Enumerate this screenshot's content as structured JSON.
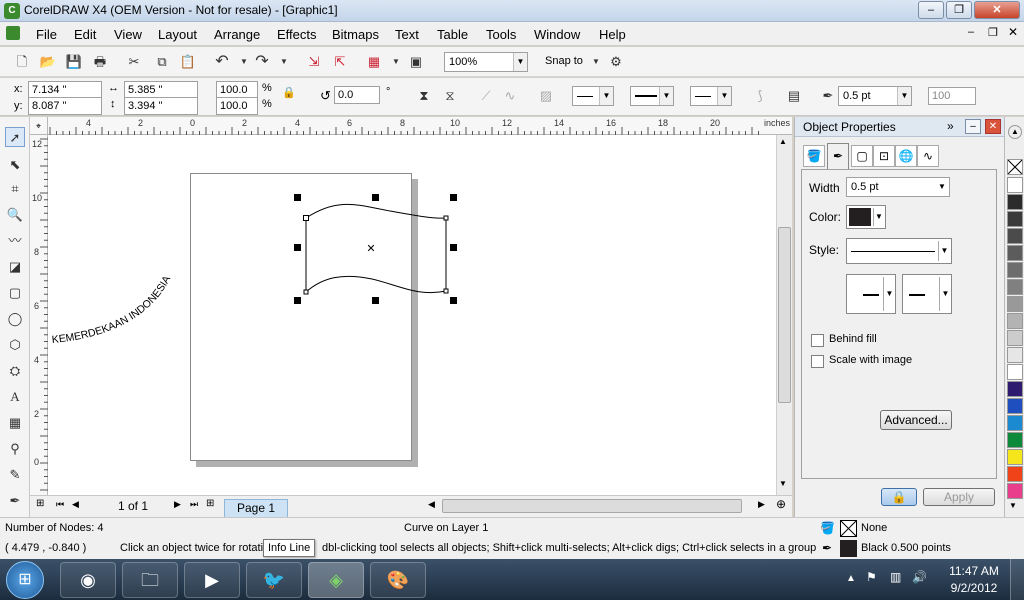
{
  "window": {
    "title": "CorelDRAW X4 (OEM Version - Not for resale) - [Graphic1]"
  },
  "menu": [
    "File",
    "Edit",
    "View",
    "Layout",
    "Arrange",
    "Effects",
    "Bitmaps",
    "Text",
    "Table",
    "Tools",
    "Window",
    "Help"
  ],
  "standard_toolbar": {
    "zoom": "100%",
    "snap_to": "Snap to"
  },
  "property_bar": {
    "x_label": "x:",
    "x": "7.134 \"",
    "y_label": "y:",
    "y": "8.087 \"",
    "w": "5.385 \"",
    "h": "3.394 \"",
    "scale_x": "100.0",
    "scale_y": "100.0",
    "pct": "%",
    "rotation": "0.0",
    "deg": "°",
    "outline_width": "0.5 pt",
    "num": "100"
  },
  "rulers": {
    "unit": "inches",
    "h_ticks": [
      "4",
      "2",
      "0",
      "2",
      "4",
      "6",
      "8",
      "10",
      "12",
      "14",
      "16",
      "18",
      "20"
    ],
    "v_ticks": [
      "12",
      "10",
      "8",
      "6",
      "4",
      "2",
      "0"
    ]
  },
  "canvas": {
    "curved_text": "KEMERDEKAAN INDONESIA"
  },
  "page_nav": {
    "count": "1 of 1",
    "tab": "Page 1"
  },
  "docker": {
    "title": "Object Properties",
    "width_label": "Width",
    "width_value": "0.5 pt",
    "color_label": "Color:",
    "style_label": "Style:",
    "behind_fill": "Behind fill",
    "scale_with_image": "Scale with image",
    "advanced": "Advanced...",
    "apply": "Apply"
  },
  "palette": [
    "#ffffff",
    "#2b2b2b",
    "#3a3a3a",
    "#4b4b4b",
    "#5c5c5c",
    "#6d6d6d",
    "#808080",
    "#999999",
    "#b3b3b3",
    "#cccccc",
    "#e6e6e6",
    "#ffffff",
    "#2e1a6e",
    "#1f4fbf",
    "#1b8ad1",
    "#0c8a3a",
    "#f5e51b",
    "#f0431a",
    "#e83e8c"
  ],
  "status": {
    "nodes": "Number of Nodes: 4",
    "object": "Curve on Layer 1",
    "coords": "( 4.479 , -0.840 )",
    "hint": "Click an object twice for rotati",
    "tooltip": "Info Line",
    "hint2": "dbl-clicking tool selects all objects; Shift+click multi-selects; Alt+click digs; Ctrl+click selects in a group",
    "fill": "None",
    "outline": "Black  0.500 points"
  },
  "taskbar": {
    "time": "11:47 AM",
    "date": "9/2/2012"
  }
}
